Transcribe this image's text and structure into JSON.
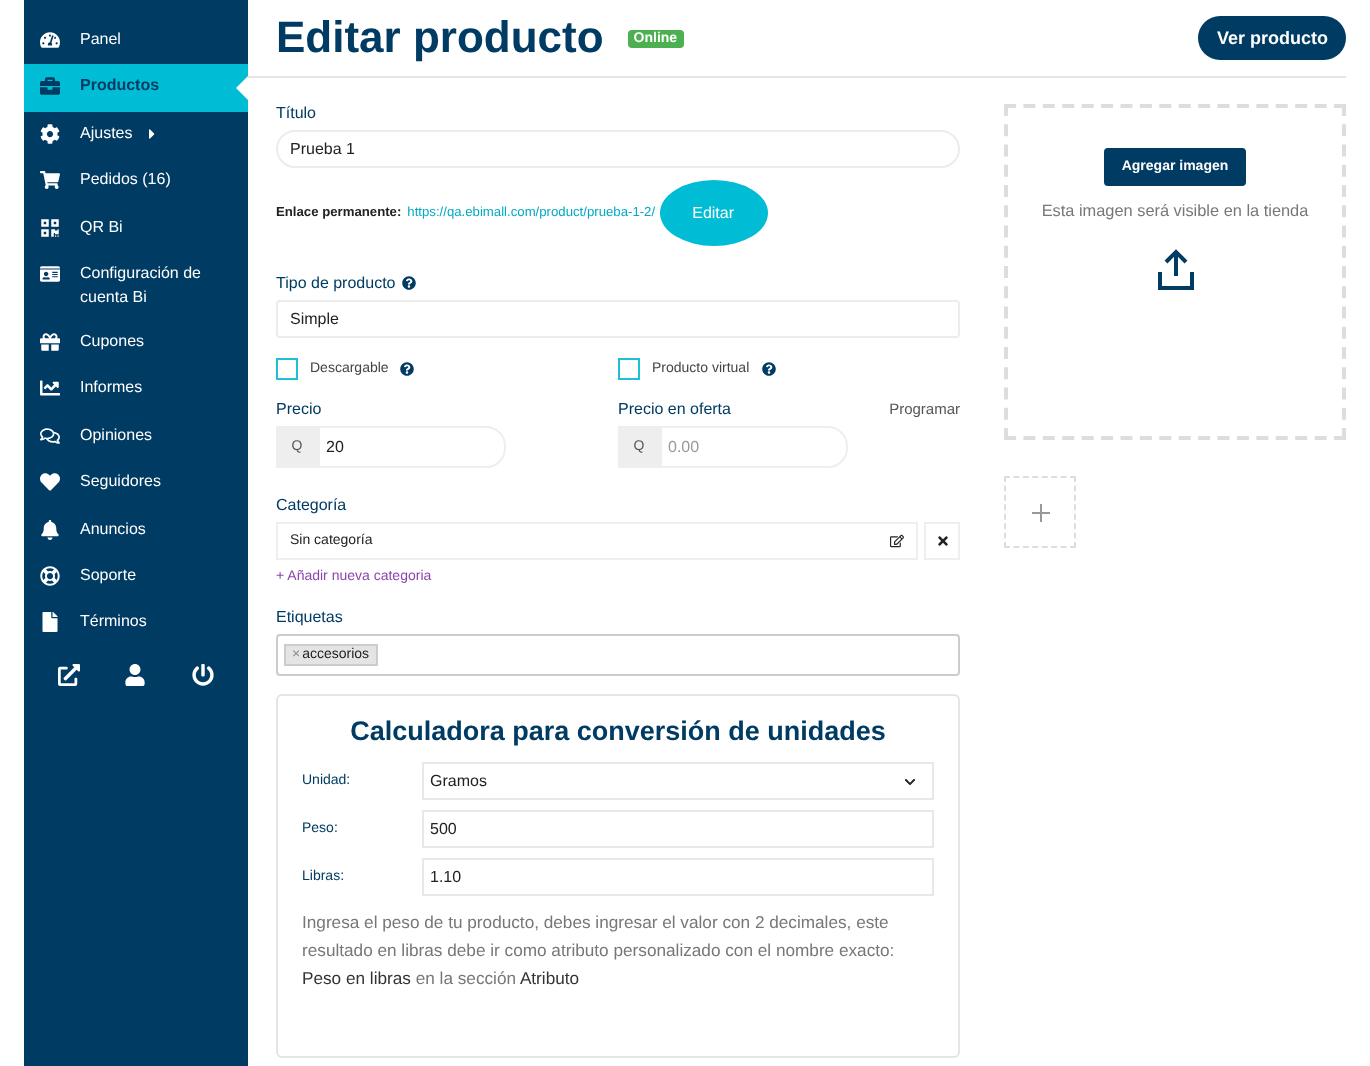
{
  "sidebar": {
    "items": [
      {
        "label": "Panel",
        "selected": false
      },
      {
        "label": "Productos",
        "selected": true
      },
      {
        "label": "Ajustes",
        "selected": false,
        "has_submenu": true
      },
      {
        "label": "Pedidos (16)",
        "selected": false
      },
      {
        "label": "QR Bi",
        "selected": false
      },
      {
        "label": "Configuración de cuenta Bi",
        "selected": false
      },
      {
        "label": "Cupones",
        "selected": false
      },
      {
        "label": "Informes",
        "selected": false
      },
      {
        "label": "Opiniones",
        "selected": false
      },
      {
        "label": "Seguidores",
        "selected": false
      },
      {
        "label": "Anuncios",
        "selected": false
      },
      {
        "label": "Soporte",
        "selected": false
      },
      {
        "label": "Términos",
        "selected": false
      }
    ]
  },
  "header": {
    "title": "Editar producto",
    "status": "Online",
    "view_button": "Ver producto"
  },
  "form": {
    "title_field": {
      "label": "Título",
      "value": "Prueba 1"
    },
    "permalink": {
      "label": "Enlace permanente:",
      "url": "https://qa.ebimall.com/product/prueba-1-2/",
      "button": "Editar"
    },
    "product_type": {
      "label": "Tipo de producto",
      "value": "Simple"
    },
    "checkboxes": [
      {
        "label": "Descargable",
        "checked": false
      },
      {
        "label": "Producto virtual",
        "checked": false
      }
    ],
    "price": {
      "label": "Precio",
      "currency": "Q",
      "value": "20"
    },
    "sale_price": {
      "label": "Precio en oferta",
      "currency": "Q",
      "placeholder": "0.00"
    },
    "schedule_link": "Programar",
    "category": {
      "label": "Categoría",
      "value": "Sin categoría"
    },
    "add_category": "+ Añadir nueva categoria",
    "tags": {
      "label": "Etiquetas",
      "remove": "×",
      "items": [
        "accesorios"
      ]
    }
  },
  "calculator": {
    "title": "Calculadora para conversión de unidades",
    "rows": [
      {
        "kind": "select",
        "label": "Unidad:",
        "value": "Gramos"
      },
      {
        "kind": "input",
        "label": "Peso:",
        "value": "500"
      },
      {
        "kind": "input",
        "label": "Libras:",
        "value": "1.10"
      }
    ],
    "note": "Ingresa el peso de tu producto, debes ingresar el valor con 2 decimales, este resultado en libras debe ir como atributo personalizado con el nombre exacto: **Peso en libras** en la sección **Atributo**"
  },
  "image_panel": {
    "button": "Agregar imagen",
    "hint": "Esta imagen será visible en la tienda"
  }
}
